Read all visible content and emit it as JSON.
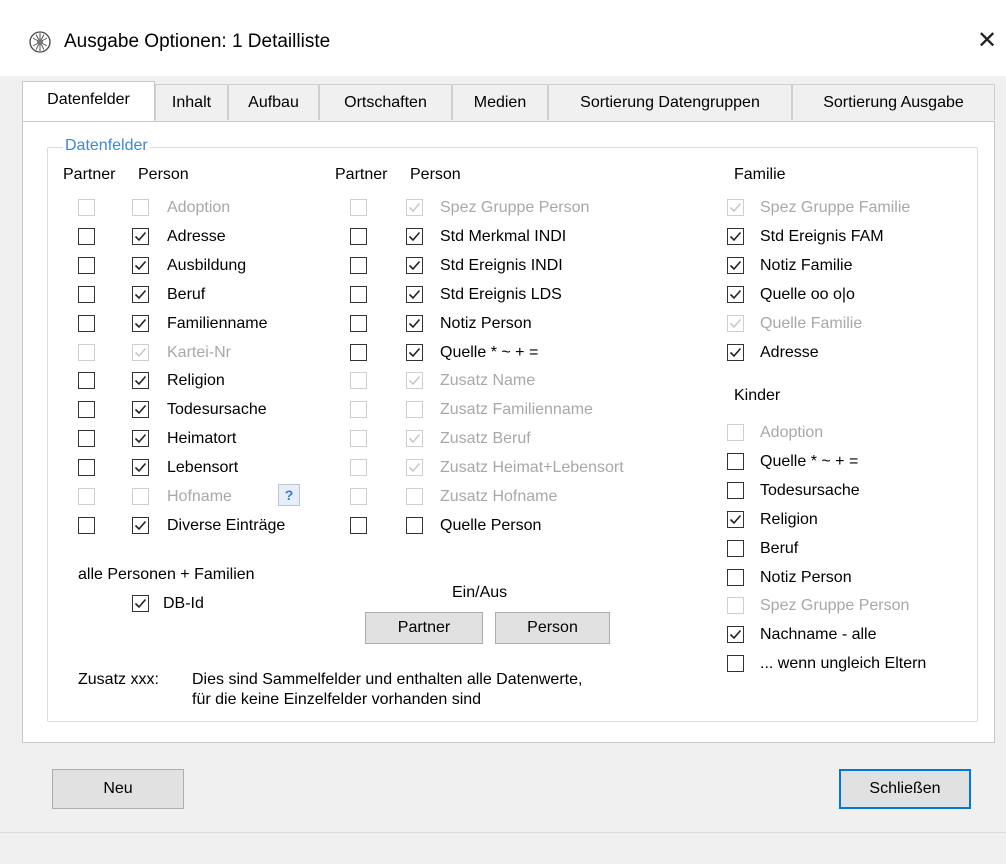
{
  "window": {
    "title": "Ausgabe Optionen: 1 Detailliste",
    "close_glyph": "✕",
    "icon": "tree-icon"
  },
  "tabs": [
    {
      "label": "Datenfelder",
      "active": true
    },
    {
      "label": "Inhalt"
    },
    {
      "label": "Aufbau"
    },
    {
      "label": "Ortschaften"
    },
    {
      "label": "Medien"
    },
    {
      "label": "Sortierung Datengruppen"
    },
    {
      "label": "Sortierung Ausgabe"
    }
  ],
  "group": {
    "label": "Datenfelder"
  },
  "col1": {
    "header_partner": "Partner",
    "header_person": "Person",
    "rows": [
      {
        "label": "Adoption",
        "partner": false,
        "person": false,
        "disabled": true
      },
      {
        "label": "Adresse",
        "partner": false,
        "person": true,
        "disabled": false
      },
      {
        "label": "Ausbildung",
        "partner": false,
        "person": true,
        "disabled": false
      },
      {
        "label": "Beruf",
        "partner": false,
        "person": true,
        "disabled": false
      },
      {
        "label": "Familienname",
        "partner": false,
        "person": true,
        "disabled": false
      },
      {
        "label": "Kartei-Nr",
        "partner": false,
        "person": true,
        "disabled": true
      },
      {
        "label": "Religion",
        "partner": false,
        "person": true,
        "disabled": false
      },
      {
        "label": "Todesursache",
        "partner": false,
        "person": true,
        "disabled": false
      },
      {
        "label": "Heimatort",
        "partner": false,
        "person": true,
        "disabled": false
      },
      {
        "label": "Lebensort",
        "partner": false,
        "person": true,
        "disabled": false
      },
      {
        "label": "Hofname",
        "partner": false,
        "person": false,
        "disabled": true
      },
      {
        "label": "Diverse Einträge",
        "partner": false,
        "person": true,
        "disabled": false
      }
    ],
    "help_label": "?"
  },
  "col2": {
    "header_partner": "Partner",
    "header_person": "Person",
    "rows": [
      {
        "label": "Spez Gruppe Person",
        "partner": false,
        "person": true,
        "disabled": true
      },
      {
        "label": "Std Merkmal INDI",
        "partner": false,
        "person": true,
        "disabled": false
      },
      {
        "label": "Std Ereignis INDI",
        "partner": false,
        "person": true,
        "disabled": false
      },
      {
        "label": "Std Ereignis LDS",
        "partner": false,
        "person": true,
        "disabled": false
      },
      {
        "label": "Notiz Person",
        "partner": false,
        "person": true,
        "disabled": false
      },
      {
        "label": "Quelle  * ~ + =",
        "partner": false,
        "person": true,
        "disabled": false
      },
      {
        "label": "Zusatz Name",
        "partner": false,
        "person": true,
        "disabled": true
      },
      {
        "label": "Zusatz Familienname",
        "partner": false,
        "person": false,
        "disabled": true
      },
      {
        "label": "Zusatz Beruf",
        "partner": false,
        "person": true,
        "disabled": true
      },
      {
        "label": "Zusatz Heimat+Lebensort",
        "partner": false,
        "person": true,
        "disabled": true
      },
      {
        "label": "Zusatz Hofname",
        "partner": false,
        "person": false,
        "disabled": true
      },
      {
        "label": "Quelle Person",
        "partner": false,
        "person": false,
        "disabled": false,
        "partner_enabled": true
      }
    ]
  },
  "familie": {
    "header": "Familie",
    "rows": [
      {
        "label": "Spez Gruppe Familie",
        "checked": true,
        "disabled": true
      },
      {
        "label": "Std Ereignis FAM",
        "checked": true,
        "disabled": false
      },
      {
        "label": "Notiz Familie",
        "checked": true,
        "disabled": false
      },
      {
        "label": "Quelle oo o|o",
        "checked": true,
        "disabled": false
      },
      {
        "label": "Quelle Familie",
        "checked": true,
        "disabled": true
      },
      {
        "label": "Adresse",
        "checked": true,
        "disabled": false
      }
    ]
  },
  "kinder": {
    "header": "Kinder",
    "rows": [
      {
        "label": "Adoption",
        "checked": false,
        "disabled": true
      },
      {
        "label": "Quelle  * ~ + =",
        "checked": false,
        "disabled": false
      },
      {
        "label": "Todesursache",
        "checked": false,
        "disabled": false
      },
      {
        "label": "Religion",
        "checked": true,
        "disabled": false
      },
      {
        "label": "Beruf",
        "checked": false,
        "disabled": false
      },
      {
        "label": "Notiz Person",
        "checked": false,
        "disabled": false
      },
      {
        "label": "Spez Gruppe Person",
        "checked": false,
        "disabled": true
      },
      {
        "label": "Nachname - alle",
        "checked": true,
        "disabled": false
      },
      {
        "label": "... wenn ungleich Eltern",
        "checked": false,
        "disabled": false
      }
    ]
  },
  "alle": {
    "label": "alle Personen + Familien",
    "dbid_label": "DB-Id",
    "dbid_checked": true
  },
  "einaus": {
    "label": "Ein/Aus",
    "partner_button": "Partner",
    "person_button": "Person"
  },
  "note": {
    "label": "Zusatz xxx:",
    "line1": "Dies sind Sammelfelder und enthalten alle Datenwerte,",
    "line2": "für die keine Einzelfelder vorhanden sind"
  },
  "footer": {
    "new_button": "Neu",
    "close_button": "Schließen"
  }
}
